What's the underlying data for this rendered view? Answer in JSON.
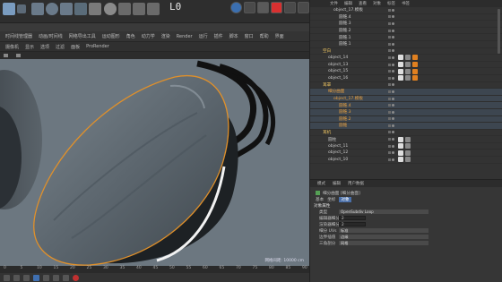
{
  "topbar": {
    "frame_label": "L0"
  },
  "menubar2": {
    "items": [
      "时间线管理器",
      "动画/时间线",
      "网络导出工具",
      "运动图形",
      "角色",
      "动力学",
      "渲染",
      "Render",
      "运行",
      "插件",
      "脚本",
      "窗口",
      "帮助",
      "界面"
    ]
  },
  "menubar3": {
    "items": [
      "摄像机",
      "显示",
      "选项",
      "过滤",
      "面板",
      "ProRender"
    ]
  },
  "viewport": {
    "info": "网格间距: 10000 cm"
  },
  "timeline": {
    "ticks": [
      "0",
      "5",
      "10",
      "15",
      "20",
      "25",
      "30",
      "35",
      "40",
      "45",
      "50",
      "55",
      "60",
      "65",
      "70",
      "75",
      "80",
      "85",
      "90"
    ]
  },
  "objmgr": {
    "tabs": [
      "文件",
      "编辑",
      "查看",
      "对象",
      "标签",
      "书签"
    ],
    "rows": [
      {
        "name": "object_17.模板",
        "cls": ""
      },
      {
        "name": "圆锥.4",
        "cls": ""
      },
      {
        "name": "圆锥.3",
        "cls": ""
      },
      {
        "name": "圆锥.2",
        "cls": ""
      },
      {
        "name": "圆锥.1",
        "cls": ""
      },
      {
        "name": "圆锥.1",
        "cls": ""
      },
      {
        "name": "空白",
        "cls": "grp"
      },
      {
        "name": "object_14",
        "cls": ""
      },
      {
        "name": "object_13",
        "cls": ""
      },
      {
        "name": "object_15",
        "cls": ""
      },
      {
        "name": "object_16",
        "cls": ""
      },
      {
        "name": "耳罩",
        "cls": "grp"
      },
      {
        "name": "细分曲面",
        "cls": "sel"
      },
      {
        "name": "object_17.模板",
        "cls": "sel"
      },
      {
        "name": "圆锥.4",
        "cls": "sel"
      },
      {
        "name": "圆锥.3",
        "cls": "sel"
      },
      {
        "name": "圆锥.2",
        "cls": "sel"
      },
      {
        "name": "圆锥",
        "cls": "sel"
      },
      {
        "name": "耳机",
        "cls": "grp"
      },
      {
        "name": "圆柱",
        "cls": ""
      },
      {
        "name": "object_11",
        "cls": ""
      },
      {
        "name": "object_12",
        "cls": ""
      },
      {
        "name": "object_10",
        "cls": ""
      }
    ]
  },
  "attrmgr": {
    "tabs": [
      "模式",
      "编辑",
      "用户数据"
    ],
    "object_title": "细分曲面 [细分曲面]",
    "tabs2": [
      "基本",
      "坐标",
      "对象"
    ],
    "section": "对象属性",
    "rows": [
      {
        "label": "类型",
        "value": "OpenSubdiv Loop",
        "kind": "dd"
      },
      {
        "label": "编辑器细分",
        "value": "2",
        "kind": "field"
      },
      {
        "label": "渲染器细分",
        "value": "2",
        "kind": "field"
      },
      {
        "label": "细分 UVs",
        "value": "标准",
        "kind": "dd"
      },
      {
        "label": "边界插值",
        "value": "边缘",
        "kind": "dd"
      },
      {
        "label": "三角剖分",
        "value": "网格",
        "kind": "dd"
      }
    ]
  }
}
